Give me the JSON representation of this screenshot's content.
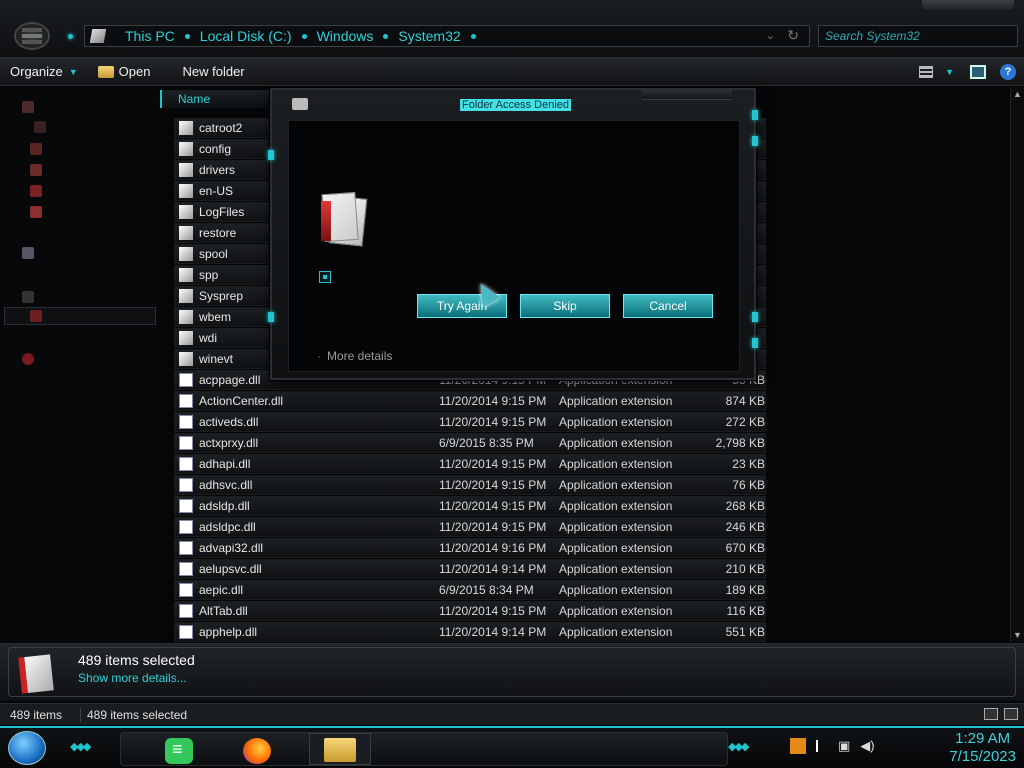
{
  "breadcrumbs": [
    "This PC",
    "Local Disk (C:)",
    "Windows",
    "System32"
  ],
  "search": {
    "placeholder": "Search System32"
  },
  "toolbar": {
    "organize": "Organize",
    "open": "Open",
    "new_folder": "New folder",
    "help": "?"
  },
  "column_header": "Name",
  "folders": [
    "catroot2",
    "config",
    "drivers",
    "en-US",
    "LogFiles",
    "restore",
    "spool",
    "spp",
    "Sysprep",
    "wbem",
    "wdi",
    "winevt"
  ],
  "files": [
    {
      "name": "acppage.dll",
      "date": "11/20/2014 9:15 PM",
      "type": "Application extension",
      "size": "55 KB"
    },
    {
      "name": "ActionCenter.dll",
      "date": "11/20/2014 9:15 PM",
      "type": "Application extension",
      "size": "874 KB"
    },
    {
      "name": "activeds.dll",
      "date": "11/20/2014 9:15 PM",
      "type": "Application extension",
      "size": "272 KB"
    },
    {
      "name": "actxprxy.dll",
      "date": "6/9/2015 8:35 PM",
      "type": "Application extension",
      "size": "2,798 KB"
    },
    {
      "name": "adhapi.dll",
      "date": "11/20/2014 9:15 PM",
      "type": "Application extension",
      "size": "23 KB"
    },
    {
      "name": "adhsvc.dll",
      "date": "11/20/2014 9:15 PM",
      "type": "Application extension",
      "size": "76 KB"
    },
    {
      "name": "adsldp.dll",
      "date": "11/20/2014 9:15 PM",
      "type": "Application extension",
      "size": "268 KB"
    },
    {
      "name": "adsldpc.dll",
      "date": "11/20/2014 9:15 PM",
      "type": "Application extension",
      "size": "246 KB"
    },
    {
      "name": "advapi32.dll",
      "date": "11/20/2014 9:16 PM",
      "type": "Application extension",
      "size": "670 KB"
    },
    {
      "name": "aelupsvc.dll",
      "date": "11/20/2014 9:14 PM",
      "type": "Application extension",
      "size": "210 KB"
    },
    {
      "name": "aepic.dll",
      "date": "6/9/2015 8:34 PM",
      "type": "Application extension",
      "size": "189 KB"
    },
    {
      "name": "AltTab.dll",
      "date": "11/20/2014 9:15 PM",
      "type": "Application extension",
      "size": "116 KB"
    },
    {
      "name": "apphelp.dll",
      "date": "11/20/2014 9:14 PM",
      "type": "Application extension",
      "size": "551 KB"
    }
  ],
  "dialog": {
    "title": "Folder Access Denied",
    "buttons": {
      "try_again": "Try Again",
      "skip": "Skip",
      "cancel": "Cancel"
    },
    "more_details": "More details"
  },
  "details": {
    "count": "489 items selected",
    "link": "Show more details..."
  },
  "status": {
    "items": "489 items",
    "selected": "489 items selected"
  },
  "clock": {
    "time": "1:29 AM",
    "date": "7/15/2023"
  },
  "colors": {
    "accent": "#20c5cf",
    "accent_text": "#2fd0d8",
    "button": "#1f9aa4",
    "background": "#050607"
  }
}
